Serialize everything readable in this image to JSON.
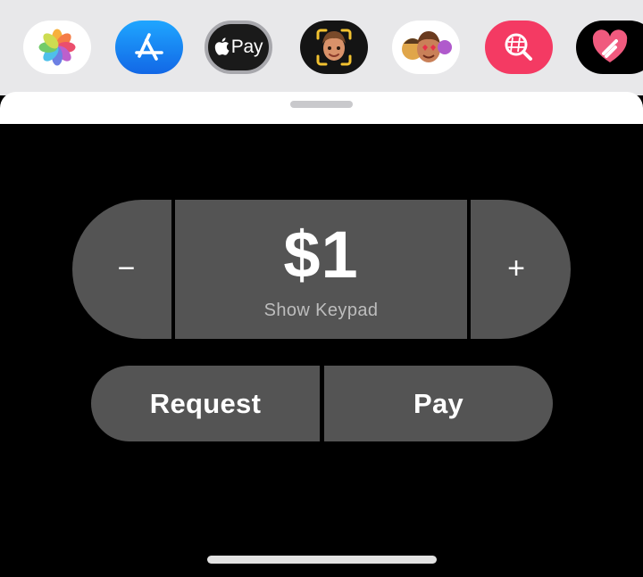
{
  "app_drawer": {
    "apps": [
      {
        "name": "Photos",
        "icon": "photos-pinwheel-icon"
      },
      {
        "name": "App Store",
        "icon": "app-store-icon"
      },
      {
        "name": "Apple Pay",
        "icon": "apple-pay-icon",
        "label": "Pay",
        "selected": true
      },
      {
        "name": "Memoji Camera",
        "icon": "memoji-camera-icon"
      },
      {
        "name": "Memoji Stickers",
        "icon": "memoji-stickers-icon"
      },
      {
        "name": "#images",
        "icon": "images-search-icon"
      },
      {
        "name": "Digital Touch",
        "icon": "digital-touch-heart-icon"
      }
    ]
  },
  "stepper": {
    "decrement": "−",
    "amount": "$1",
    "keypad_label": "Show Keypad",
    "increment": "+"
  },
  "actions": {
    "request_label": "Request",
    "pay_label": "Pay"
  },
  "colors": {
    "background": "#000000",
    "button_fill": "#545454",
    "app_strip": "#e8e8ea",
    "app_store_blue": "#1a8cff",
    "images_pink": "#f43a63"
  }
}
